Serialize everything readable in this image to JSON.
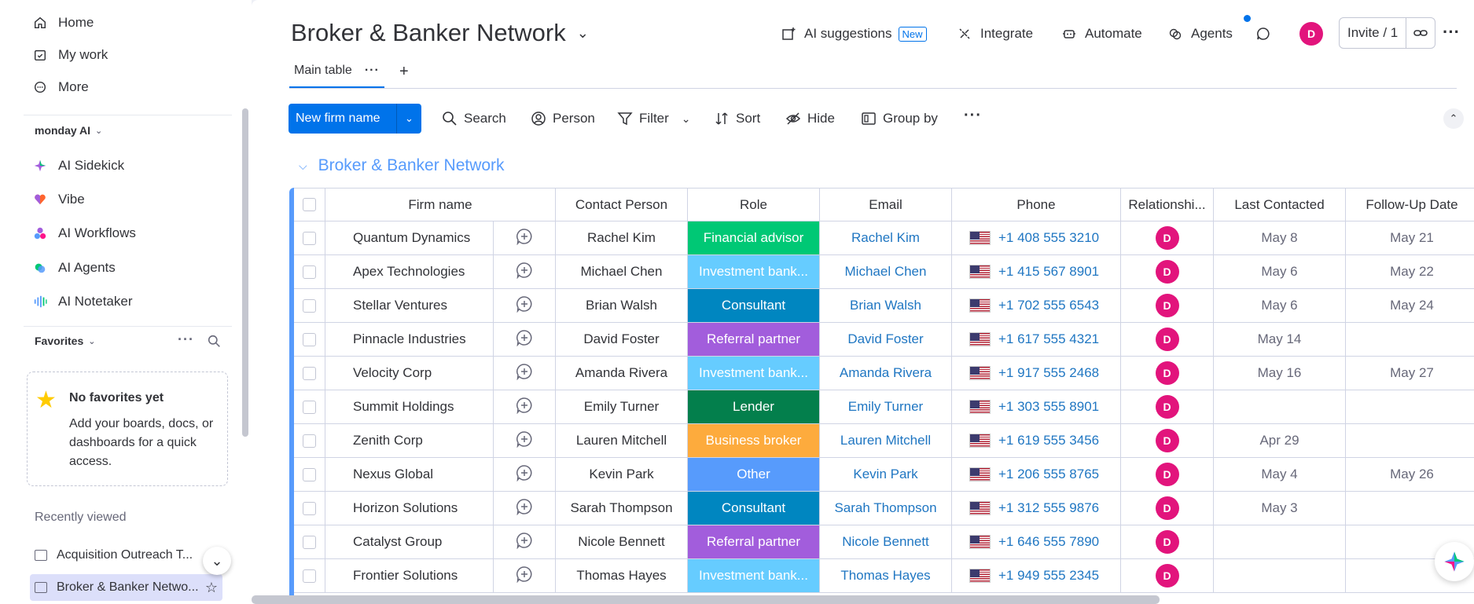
{
  "sidebar": {
    "nav": [
      {
        "label": "Home",
        "icon": "home-icon"
      },
      {
        "label": "My work",
        "icon": "calendar-check-icon"
      },
      {
        "label": "More",
        "icon": "more-circle-icon"
      }
    ],
    "ai_section_label": "monday AI",
    "ai_items": [
      {
        "label": "AI Sidekick",
        "icon": "sparkle-icon",
        "color": "#00c875"
      },
      {
        "label": "Vibe",
        "icon": "heart-icon",
        "color": "#ff642e"
      },
      {
        "label": "AI Workflows",
        "icon": "workflow-icon",
        "color": "#a25ddc"
      },
      {
        "label": "AI Agents",
        "icon": "agents-icon",
        "color": "#00c875"
      },
      {
        "label": "AI Notetaker",
        "icon": "waveform-icon",
        "color": "#579bfc"
      }
    ],
    "favorites_label": "Favorites",
    "favorites_empty_title": "No favorites yet",
    "favorites_empty_desc": "Add your boards, docs, or dashboards for a quick access.",
    "recent_label": "Recently viewed",
    "recent_items": [
      "Acquisition Outreach T...",
      "Broker & Banker Netwo..."
    ]
  },
  "header": {
    "title": "Broker & Banker Network",
    "ai_suggestions": "AI suggestions",
    "new_badge": "New",
    "integrate": "Integrate",
    "automate": "Automate",
    "agents": "Agents",
    "avatar_initial": "D",
    "invite": "Invite / 1"
  },
  "tabs": {
    "main_table": "Main table"
  },
  "toolbar": {
    "new_item": "New firm name",
    "search": "Search",
    "person": "Person",
    "filter": "Filter",
    "sort": "Sort",
    "hide": "Hide",
    "group_by": "Group by"
  },
  "group": {
    "title": "Broker & Banker Network"
  },
  "columns": [
    "Firm name",
    "Contact Person",
    "Role",
    "Email",
    "Phone",
    "Relationshi...",
    "Last Contacted",
    "Follow-Up Date"
  ],
  "role_colors": {
    "Financial advisor": "#00c875",
    "Investment bank...": "#66ccff",
    "Consultant": "#0086c0",
    "Referral partner": "#a25ddc",
    "Lender": "#037f4c",
    "Business broker": "#fdab3d",
    "Other": "#579bfc"
  },
  "rows": [
    {
      "firm": "Quantum Dynamics",
      "contact": "Rachel Kim",
      "role": "Financial advisor",
      "email": "Rachel Kim",
      "phone": "+1 408 555 3210",
      "rel": "D",
      "last": "May 8",
      "follow": "May 21"
    },
    {
      "firm": "Apex Technologies",
      "contact": "Michael Chen",
      "role": "Investment bank...",
      "email": "Michael Chen",
      "phone": "+1 415 567 8901",
      "rel": "D",
      "last": "May 6",
      "follow": "May 22"
    },
    {
      "firm": "Stellar Ventures",
      "contact": "Brian Walsh",
      "role": "Consultant",
      "email": "Brian Walsh",
      "phone": "+1 702 555 6543",
      "rel": "D",
      "last": "May 6",
      "follow": "May 24"
    },
    {
      "firm": "Pinnacle Industries",
      "contact": "David Foster",
      "role": "Referral partner",
      "email": "David Foster",
      "phone": "+1 617 555 4321",
      "rel": "D",
      "last": "May 14",
      "follow": ""
    },
    {
      "firm": "Velocity Corp",
      "contact": "Amanda Rivera",
      "role": "Investment bank...",
      "email": "Amanda Rivera",
      "phone": "+1 917 555 2468",
      "rel": "D",
      "last": "May 16",
      "follow": "May 27"
    },
    {
      "firm": "Summit Holdings",
      "contact": "Emily Turner",
      "role": "Lender",
      "email": "Emily Turner",
      "phone": "+1 303 555 8901",
      "rel": "D",
      "last": "",
      "follow": ""
    },
    {
      "firm": "Zenith Corp",
      "contact": "Lauren Mitchell",
      "role": "Business broker",
      "email": "Lauren Mitchell",
      "phone": "+1 619 555 3456",
      "rel": "D",
      "last": "Apr 29",
      "follow": ""
    },
    {
      "firm": "Nexus Global",
      "contact": "Kevin Park",
      "role": "Other",
      "email": "Kevin Park",
      "phone": "+1 206 555 8765",
      "rel": "D",
      "last": "May 4",
      "follow": "May 26"
    },
    {
      "firm": "Horizon Solutions",
      "contact": "Sarah Thompson",
      "role": "Consultant",
      "email": "Sarah Thompson",
      "phone": "+1 312 555 9876",
      "rel": "D",
      "last": "May 3",
      "follow": ""
    },
    {
      "firm": "Catalyst Group",
      "contact": "Nicole Bennett",
      "role": "Referral partner",
      "email": "Nicole Bennett",
      "phone": "+1 646 555 7890",
      "rel": "D",
      "last": "",
      "follow": ""
    },
    {
      "firm": "Frontier Solutions",
      "contact": "Thomas Hayes",
      "role": "Investment bank...",
      "email": "Thomas Hayes",
      "phone": "+1 949 555 2345",
      "rel": "D",
      "last": "",
      "follow": ""
    }
  ]
}
